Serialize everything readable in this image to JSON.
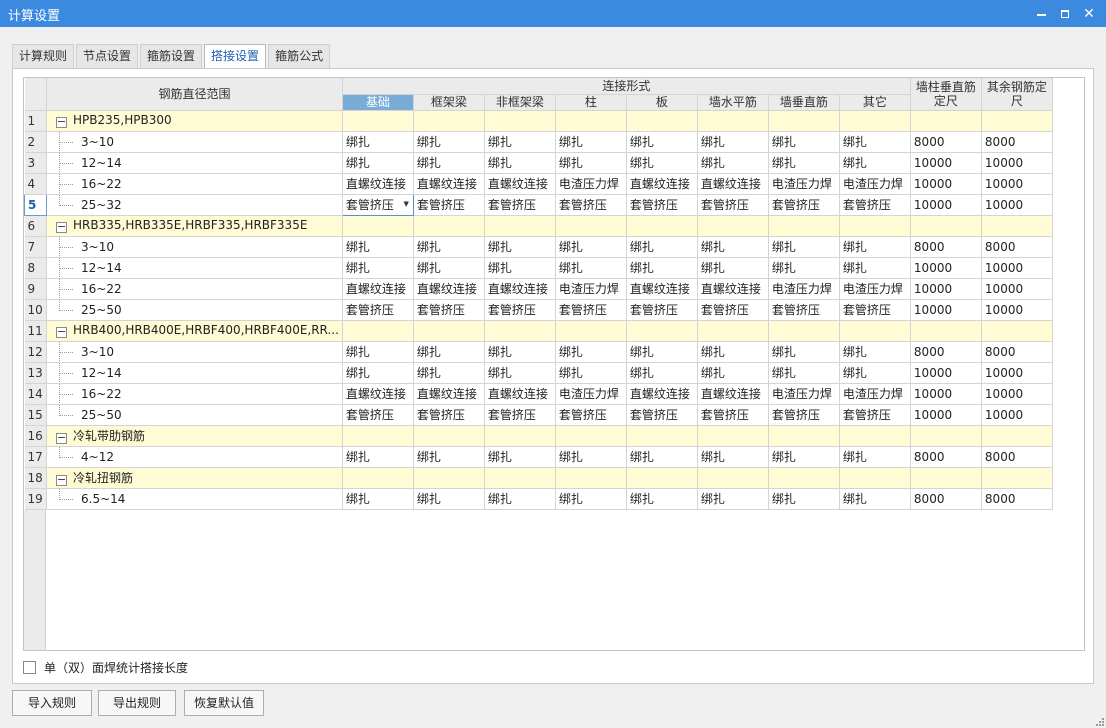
{
  "window": {
    "title": "计算设置"
  },
  "tabs": [
    {
      "label": "计算规则",
      "active": false
    },
    {
      "label": "节点设置",
      "active": false
    },
    {
      "label": "箍筋设置",
      "active": false
    },
    {
      "label": "搭接设置",
      "active": true
    },
    {
      "label": "箍筋公式",
      "active": false
    }
  ],
  "grid": {
    "range_header": "钢筋直径范围",
    "group_header": "连接形式",
    "sub_headers": [
      "基础",
      "框架梁",
      "非框架梁",
      "柱",
      "板",
      "墙水平筋",
      "墙垂直筋",
      "其它"
    ],
    "wall_col_header": "墙柱垂直筋定尺",
    "other_col_header": "其余钢筋定尺",
    "selected_row": 5,
    "rows": [
      {
        "num": "1",
        "type": "group",
        "label": "HPB235,HPB300"
      },
      {
        "num": "2",
        "type": "child",
        "label": "3~10",
        "cells": [
          "绑扎",
          "绑扎",
          "绑扎",
          "绑扎",
          "绑扎",
          "绑扎",
          "绑扎",
          "绑扎",
          "8000",
          "8000"
        ]
      },
      {
        "num": "3",
        "type": "child",
        "label": "12~14",
        "cells": [
          "绑扎",
          "绑扎",
          "绑扎",
          "绑扎",
          "绑扎",
          "绑扎",
          "绑扎",
          "绑扎",
          "10000",
          "10000"
        ]
      },
      {
        "num": "4",
        "type": "child",
        "label": "16~22",
        "cells": [
          "直螺纹连接",
          "直螺纹连接",
          "直螺纹连接",
          "电渣压力焊",
          "直螺纹连接",
          "直螺纹连接",
          "电渣压力焊",
          "电渣压力焊",
          "10000",
          "10000"
        ]
      },
      {
        "num": "5",
        "type": "child",
        "label": "25~32",
        "last": true,
        "cells": [
          "套管挤压",
          "套管挤压",
          "套管挤压",
          "套管挤压",
          "套管挤压",
          "套管挤压",
          "套管挤压",
          "套管挤压",
          "10000",
          "10000"
        ]
      },
      {
        "num": "6",
        "type": "group",
        "label": "HRB335,HRB335E,HRBF335,HRBF335E"
      },
      {
        "num": "7",
        "type": "child",
        "label": "3~10",
        "cells": [
          "绑扎",
          "绑扎",
          "绑扎",
          "绑扎",
          "绑扎",
          "绑扎",
          "绑扎",
          "绑扎",
          "8000",
          "8000"
        ]
      },
      {
        "num": "8",
        "type": "child",
        "label": "12~14",
        "cells": [
          "绑扎",
          "绑扎",
          "绑扎",
          "绑扎",
          "绑扎",
          "绑扎",
          "绑扎",
          "绑扎",
          "10000",
          "10000"
        ]
      },
      {
        "num": "9",
        "type": "child",
        "label": "16~22",
        "cells": [
          "直螺纹连接",
          "直螺纹连接",
          "直螺纹连接",
          "电渣压力焊",
          "直螺纹连接",
          "直螺纹连接",
          "电渣压力焊",
          "电渣压力焊",
          "10000",
          "10000"
        ]
      },
      {
        "num": "10",
        "type": "child",
        "label": "25~50",
        "last": true,
        "cells": [
          "套管挤压",
          "套管挤压",
          "套管挤压",
          "套管挤压",
          "套管挤压",
          "套管挤压",
          "套管挤压",
          "套管挤压",
          "10000",
          "10000"
        ]
      },
      {
        "num": "11",
        "type": "group",
        "label": "HRB400,HRB400E,HRBF400,HRBF400E,RR..."
      },
      {
        "num": "12",
        "type": "child",
        "label": "3~10",
        "cells": [
          "绑扎",
          "绑扎",
          "绑扎",
          "绑扎",
          "绑扎",
          "绑扎",
          "绑扎",
          "绑扎",
          "8000",
          "8000"
        ]
      },
      {
        "num": "13",
        "type": "child",
        "label": "12~14",
        "cells": [
          "绑扎",
          "绑扎",
          "绑扎",
          "绑扎",
          "绑扎",
          "绑扎",
          "绑扎",
          "绑扎",
          "10000",
          "10000"
        ]
      },
      {
        "num": "14",
        "type": "child",
        "label": "16~22",
        "cells": [
          "直螺纹连接",
          "直螺纹连接",
          "直螺纹连接",
          "电渣压力焊",
          "直螺纹连接",
          "直螺纹连接",
          "电渣压力焊",
          "电渣压力焊",
          "10000",
          "10000"
        ]
      },
      {
        "num": "15",
        "type": "child",
        "label": "25~50",
        "last": true,
        "cells": [
          "套管挤压",
          "套管挤压",
          "套管挤压",
          "套管挤压",
          "套管挤压",
          "套管挤压",
          "套管挤压",
          "套管挤压",
          "10000",
          "10000"
        ]
      },
      {
        "num": "16",
        "type": "group",
        "label": "冷轧带肋钢筋"
      },
      {
        "num": "17",
        "type": "child",
        "label": "4~12",
        "last": true,
        "cells": [
          "绑扎",
          "绑扎",
          "绑扎",
          "绑扎",
          "绑扎",
          "绑扎",
          "绑扎",
          "绑扎",
          "8000",
          "8000"
        ]
      },
      {
        "num": "18",
        "type": "group",
        "label": "冷轧扭钢筋"
      },
      {
        "num": "19",
        "type": "child",
        "label": "6.5~14",
        "last": true,
        "cells": [
          "绑扎",
          "绑扎",
          "绑扎",
          "绑扎",
          "绑扎",
          "绑扎",
          "绑扎",
          "绑扎",
          "8000",
          "8000"
        ]
      }
    ]
  },
  "options": {
    "checkbox_label": "单（双）面焊统计搭接长度",
    "checked": false
  },
  "buttons": {
    "import": "导入规则",
    "export": "导出规则",
    "restore": "恢复默认值"
  },
  "colors": {
    "titlebar": "#3b8ae0",
    "header_group": "#7aacd8",
    "group_row": "#fffbd4"
  }
}
